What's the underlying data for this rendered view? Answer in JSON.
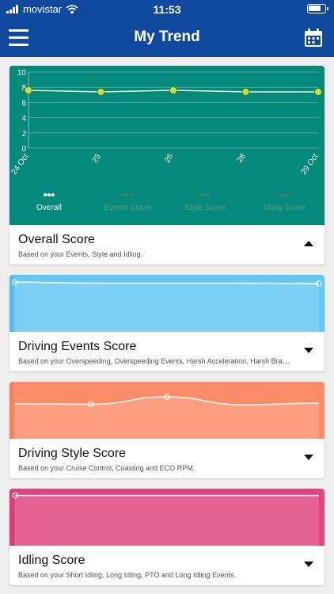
{
  "status_bar": {
    "carrier": "movistar",
    "time": "11:53"
  },
  "header": {
    "title": "My Trend"
  },
  "overall": {
    "name": "Overall Score",
    "description": "Based on your Events, Style and Idling.",
    "color": "#05897a",
    "chart_data": {
      "type": "line",
      "x": [
        "24 Oct",
        "25",
        "26",
        "28",
        "29 Oct"
      ],
      "series": [
        {
          "name": "Overall",
          "values": [
            7.6,
            7.4,
            7.6,
            7.4,
            7.4
          ]
        }
      ],
      "ylim": [
        0,
        10
      ],
      "yticks": [
        "0",
        "2",
        "4",
        "6",
        "8",
        "10"
      ],
      "grid": true,
      "legend_position": "bottom"
    },
    "legend": [
      "Overall",
      "Events Score",
      "Style Score",
      "Idling Score"
    ]
  },
  "events": {
    "name": "Driving Events Score",
    "description": "Based on your Overspeeding, Overspeeding Events, Harsh Acceleration, Harsh Braking...",
    "color": "#63c8f4",
    "chart_data": {
      "type": "area",
      "values": [
        9.8,
        9.6,
        9.6,
        9.6,
        9.5
      ]
    }
  },
  "style": {
    "name": "Driving Style Score",
    "description": "Based on your Cruise Control, Coasting and ECO RPM.",
    "color": "#fd8d68",
    "chart_data": {
      "type": "area",
      "values": [
        6.8,
        6.7,
        8.2,
        6.6,
        6.9
      ]
    }
  },
  "idling": {
    "name": "Idling Score",
    "description": "Based on your Short Idling, Long Idling, PTO and Long Idling Events.",
    "color": "#e0457e",
    "chart_data": {
      "type": "area",
      "values": [
        9.9,
        9.9,
        9.9,
        9.9,
        9.9
      ]
    }
  }
}
